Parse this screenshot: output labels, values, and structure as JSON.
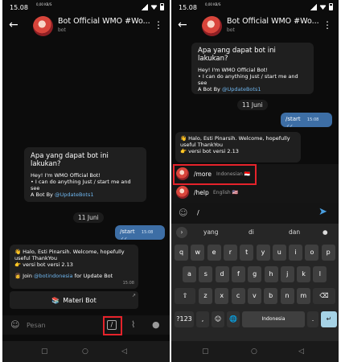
{
  "left": {
    "status": {
      "time": "15.08",
      "network": "0,00 KB/S"
    },
    "header": {
      "title": "Bot Official WMO #Wo...",
      "subtitle": "bot"
    },
    "intro": {
      "question": "Apa yang dapat bot ini lakukan?",
      "line1": "Hey! I'm WMO Official Bot!",
      "line2": "• I can do anything Just / start me and see",
      "by_prefix": "A Bot By ",
      "by_link": "@UpdateBots1"
    },
    "day": "11 Juni",
    "sent": {
      "text": "/start",
      "time": "15:08",
      "ticks": "✓✓"
    },
    "reply": {
      "line1": "👋 Halo, Esti Pinarsih. Welcome, hopefully useful ThankYou",
      "line2": "👉 versi bot versi 2.13",
      "join_prefix": "👩 Join ",
      "join_link": "@botindonesia",
      "join_suffix": " for Update Bot",
      "time": "15:08"
    },
    "inline_button": {
      "label": "Materi Bot",
      "icon": "📚"
    },
    "input": {
      "placeholder": "Pesan"
    }
  },
  "right": {
    "status": {
      "time": "15.08",
      "network": "0,00 KB/S"
    },
    "header": {
      "title": "Bot Official WMO #Wo...",
      "subtitle": "bot"
    },
    "intro": {
      "question": "Apa yang dapat bot ini lakukan?",
      "line1": "Hey! I'm WMO Official Bot!",
      "line2": "• I can do anything Just / start me and see",
      "by_prefix": "A Bot By ",
      "by_link": "@UpdateBots1"
    },
    "day": "11 Juni",
    "sent": {
      "text": "/start",
      "time": "15:08",
      "ticks": "✓✓"
    },
    "reply": {
      "line1": "👋 Halo, Esti Pinarsih. Welcome, hopefully useful ThankYou",
      "line2": "👉 versi bot versi 2.13"
    },
    "commands": [
      {
        "name": "/more",
        "desc": "Indonesian 🇮🇩"
      },
      {
        "name": "/help",
        "desc": "English 🇺🇸"
      }
    ],
    "input": {
      "value": "/"
    },
    "suggestions": [
      "yang",
      "di",
      "dan"
    ],
    "keyboard": {
      "row1": [
        "q",
        "w",
        "e",
        "r",
        "t",
        "y",
        "u",
        "i",
        "o",
        "p"
      ],
      "row1_hints": [
        "1",
        "2",
        "3",
        "4",
        "5",
        "6",
        "7",
        "8",
        "9",
        "0"
      ],
      "row2": [
        "a",
        "s",
        "d",
        "f",
        "g",
        "h",
        "j",
        "k",
        "l"
      ],
      "row3": [
        "z",
        "x",
        "c",
        "v",
        "b",
        "n",
        "m"
      ],
      "shift": "⇧",
      "backspace": "⌫",
      "sym": "?123",
      "comma": ",",
      "emoji": "☺",
      "globe": "🌐",
      "space": "Indonesia",
      "period": ".",
      "enter": "↵"
    }
  },
  "colors": {
    "background": "#0c0c0c",
    "bubble_in": "#1f1f1f",
    "bubble_out": "#3d6ea5",
    "link": "#6fb7f0",
    "highlight": "#e5232b",
    "send": "#4a9fe0"
  },
  "icons": {
    "back": "arrow-left-icon",
    "menu": "kebab-icon",
    "sticker": "sticker-icon",
    "slash": "slash-command-icon",
    "attach": "paperclip-icon",
    "mic": "microphone-icon",
    "send": "send-icon"
  }
}
